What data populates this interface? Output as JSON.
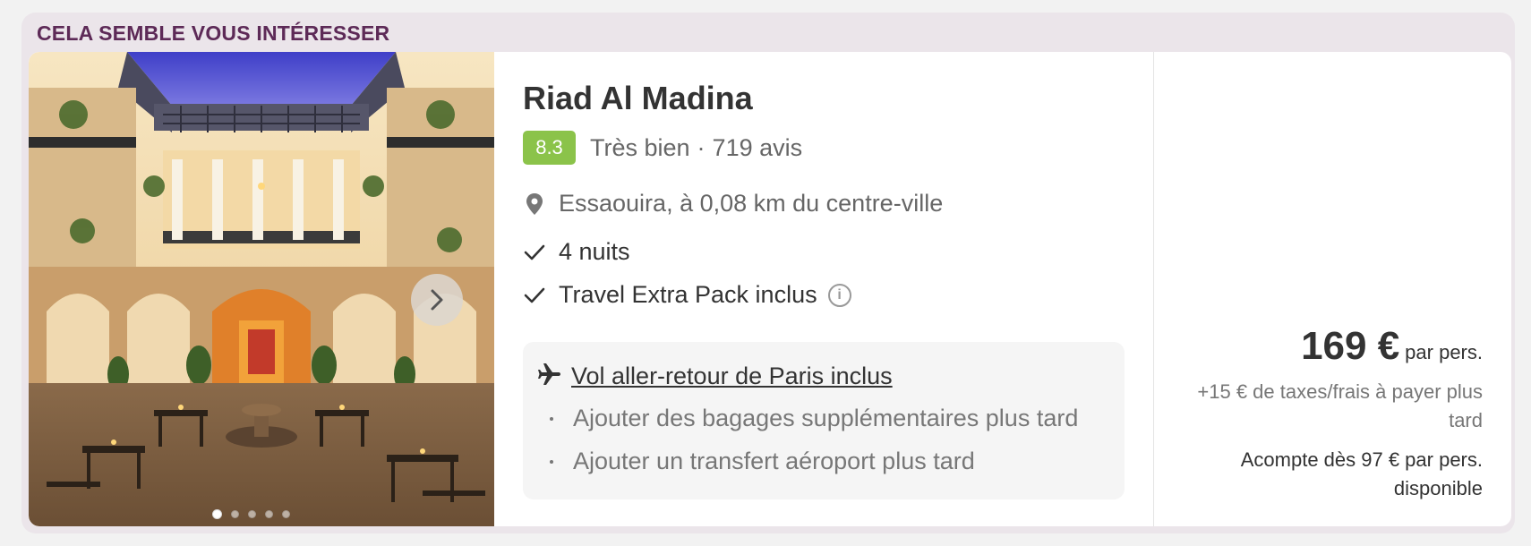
{
  "section": {
    "title": "CELA SEMBLE VOUS INTÉRESSER"
  },
  "hotel": {
    "name": "Riad Al Madina",
    "rating": "8.3",
    "rating_label": "Très bien",
    "separator": "·",
    "reviews": "719 avis",
    "location": "Essaouira, à 0,08 km du centre-ville",
    "features": [
      "4 nuits",
      "Travel Extra Pack inclus"
    ],
    "info_glyph": "i"
  },
  "flight": {
    "label": "Vol aller-retour de Paris inclus",
    "extras": [
      "Ajouter des bagages supplémentaires plus tard",
      "Ajouter un transfert aéroport plus tard"
    ]
  },
  "price": {
    "amount": "169 €",
    "per": "par pers.",
    "taxes": "+15 € de taxes/frais à payer plus tard",
    "deposit": "Acompte dès 97 € par pers. disponible"
  },
  "gallery": {
    "dot_count": 5,
    "active_index": 0
  },
  "icons": {
    "location": "map-pin-icon",
    "check": "check-icon",
    "info": "info-icon",
    "plane": "plane-icon",
    "next": "chevron-right-icon"
  },
  "colors": {
    "accent": "#5d2a57",
    "rating_badge": "#8bc34a",
    "section_bg": "#ebe5ea",
    "flight_box": "#f5f5f5"
  }
}
